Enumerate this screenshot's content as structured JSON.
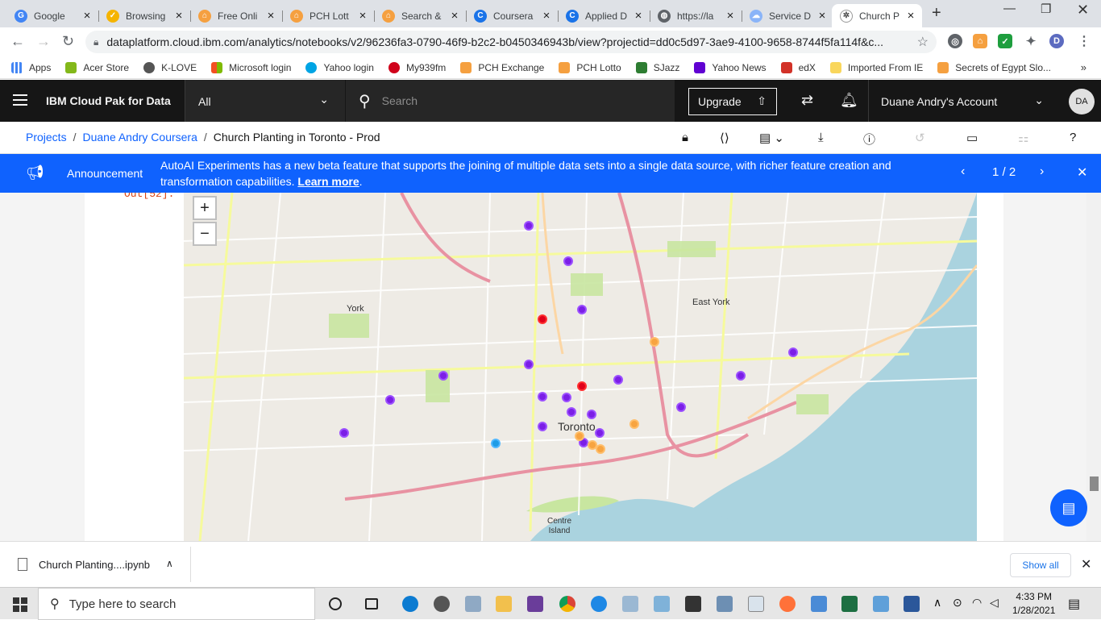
{
  "browser": {
    "tabs": [
      {
        "title": "Google",
        "icon": "google-icon",
        "color": "#4285f4"
      },
      {
        "title": "Browsing",
        "icon": "checkmark-icon",
        "color": "#f5b400"
      },
      {
        "title": "Free Onli",
        "icon": "pch-icon",
        "color": "#f5a040"
      },
      {
        "title": "PCH Lott",
        "icon": "pch-icon",
        "color": "#f5a040"
      },
      {
        "title": "Search &",
        "icon": "pch-icon",
        "color": "#f5a040"
      },
      {
        "title": "Coursera",
        "icon": "coursera-icon",
        "color": "#1a73e8"
      },
      {
        "title": "Applied D",
        "icon": "coursera-icon",
        "color": "#1a73e8"
      },
      {
        "title": "https://la",
        "icon": "globe-icon",
        "color": "#5f6368"
      },
      {
        "title": "Service D",
        "icon": "cloud-icon",
        "color": "#8ab4f8"
      },
      {
        "title": "Church P",
        "icon": "ibm-bee-icon",
        "color": "#444444"
      }
    ],
    "url": "dataplatform.cloud.ibm.com/analytics/notebooks/v2/96236fa3-0790-46f9-b2c2-b0450346943b/view?projectid=dd0c5d97-3ae9-4100-9658-8744f5fa114f&c...",
    "profile_initial": "D",
    "bookmarks": [
      "Apps",
      "Acer Store",
      "K-LOVE",
      "Microsoft login",
      "Yahoo login",
      "My939fm",
      "PCH Exchange",
      "PCH Lotto",
      "SJazz",
      "Yahoo News",
      "edX",
      "Imported From IE",
      "Secrets of Egypt Slo..."
    ]
  },
  "header": {
    "brand": "IBM Cloud Pak for Data",
    "scope": "All",
    "search_placeholder": "Search",
    "upgrade": "Upgrade",
    "account": "Duane Andry's Account",
    "avatar": "DA"
  },
  "breadcrumb": {
    "projects": "Projects",
    "project": "Duane Andry Coursera",
    "notebook": "Church Planting in Toronto - Prod"
  },
  "announcement": {
    "title": "Announcement",
    "text": "AutoAI Experiments has a new beta feature that supports the joining of multiple data sets into a single data source, with richer feature creation and transformation capabilities.",
    "link": "Learn more",
    "page": "1 / 2"
  },
  "notebook": {
    "out_label": "Out[52]:",
    "map_labels": [
      "York",
      "East York",
      "Toronto",
      "Centre Island"
    ],
    "markers": [
      {
        "color": "purple"
      },
      {
        "color": "purple"
      },
      {
        "color": "purple"
      },
      {
        "color": "red"
      },
      {
        "color": "purple"
      },
      {
        "color": "purple"
      },
      {
        "color": "red"
      },
      {
        "color": "purple"
      },
      {
        "color": "orange"
      },
      {
        "color": "blue"
      }
    ]
  },
  "download": {
    "file": "Church Planting....ipynb",
    "show_all": "Show all"
  },
  "taskbar": {
    "search": "Type here to search",
    "time": "4:33 PM",
    "date": "1/28/2021"
  }
}
